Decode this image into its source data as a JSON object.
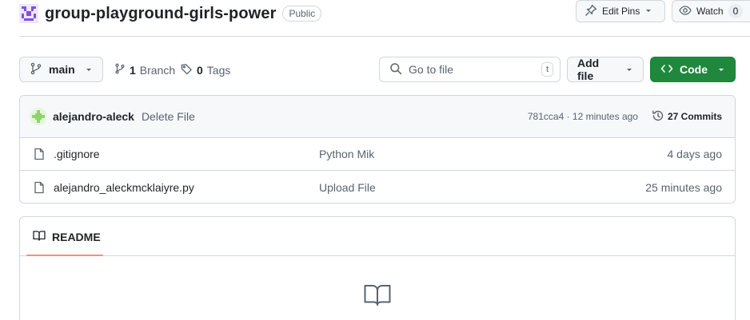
{
  "repo": {
    "name": "group-playground-girls-power",
    "visibility": "Public"
  },
  "header_actions": {
    "edit_pins_label": "Edit Pins",
    "watch_label": "Watch",
    "watch_count": "0"
  },
  "toolbar": {
    "branch_name": "main",
    "branch_count": "1",
    "branch_label": "Branch",
    "tags_count": "0",
    "tags_label": "Tags",
    "search_placeholder": "Go to file",
    "search_shortcut": "t",
    "add_file_label": "Add file",
    "code_label": "Code"
  },
  "latest_commit": {
    "author": "alejandro-aleck",
    "message": "Delete File",
    "meta": "781cca4 · 12 minutes ago",
    "commits_label": "27 Commits"
  },
  "files": [
    {
      "name": ".gitignore",
      "commit_message": "Python Mik",
      "time": "4 days ago"
    },
    {
      "name": "alejandro_aleckmcklaiyre.py",
      "commit_message": "Upload File",
      "time": "25 minutes ago"
    }
  ],
  "readme": {
    "tab_label": "README"
  },
  "colors": {
    "code_button": "#1f883d",
    "tab_underline": "#fd8c73",
    "repo_avatar": "#8250df"
  }
}
